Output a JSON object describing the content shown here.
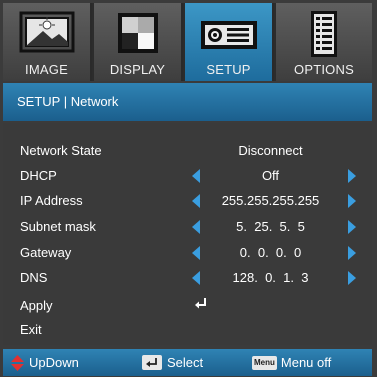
{
  "tabs": [
    {
      "label": "IMAGE",
      "icon": "image-icon",
      "active": false
    },
    {
      "label": "DISPLAY",
      "icon": "display-icon",
      "active": false
    },
    {
      "label": "SETUP",
      "icon": "projector-icon",
      "active": true
    },
    {
      "label": "OPTIONS",
      "icon": "options-icon",
      "active": false
    }
  ],
  "title": "SETUP | Network",
  "rows": [
    {
      "name": "Network State",
      "value": "Disconnect",
      "arrows": false,
      "enter": false
    },
    {
      "name": "DHCP",
      "value": "Off",
      "arrows": true,
      "enter": false
    },
    {
      "name": "IP Address",
      "value": "255.255.255.255",
      "arrows": true,
      "enter": false
    },
    {
      "name": "Subnet mask",
      "value": "5.  25.  5.  5",
      "arrows": true,
      "enter": false
    },
    {
      "name": "Gateway",
      "value": "0.  0.  0.  0",
      "arrows": true,
      "enter": false
    },
    {
      "name": "DNS",
      "value": "128.  0.  1.  3",
      "arrows": true,
      "enter": false
    },
    {
      "name": "Apply",
      "value": "",
      "arrows": false,
      "enter": true
    },
    {
      "name": "Exit",
      "value": "",
      "arrows": false,
      "enter": false
    }
  ],
  "footer": {
    "updown": "UpDown",
    "select": "Select",
    "menu_key": "Menu",
    "menu_off": "Menu off"
  },
  "colors": {
    "accent": "#2a7fb5",
    "arrow": "#3a9ee0",
    "background": "#3a3a3a"
  }
}
